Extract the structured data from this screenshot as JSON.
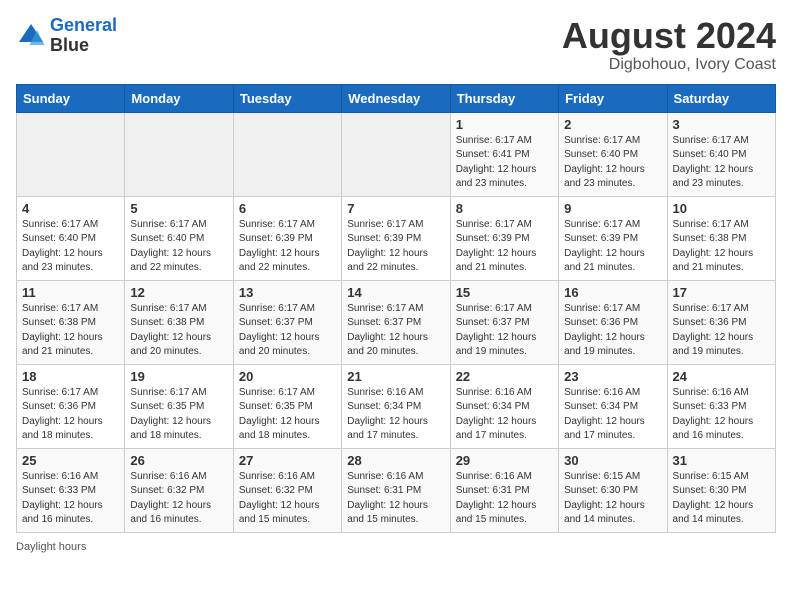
{
  "header": {
    "logo_line1": "General",
    "logo_line2": "Blue",
    "title": "August 2024",
    "subtitle": "Digbohouo, Ivory Coast"
  },
  "days_of_week": [
    "Sunday",
    "Monday",
    "Tuesday",
    "Wednesday",
    "Thursday",
    "Friday",
    "Saturday"
  ],
  "weeks": [
    [
      {
        "day": "",
        "detail": ""
      },
      {
        "day": "",
        "detail": ""
      },
      {
        "day": "",
        "detail": ""
      },
      {
        "day": "",
        "detail": ""
      },
      {
        "day": "1",
        "detail": "Sunrise: 6:17 AM\nSunset: 6:41 PM\nDaylight: 12 hours\nand 23 minutes."
      },
      {
        "day": "2",
        "detail": "Sunrise: 6:17 AM\nSunset: 6:40 PM\nDaylight: 12 hours\nand 23 minutes."
      },
      {
        "day": "3",
        "detail": "Sunrise: 6:17 AM\nSunset: 6:40 PM\nDaylight: 12 hours\nand 23 minutes."
      }
    ],
    [
      {
        "day": "4",
        "detail": "Sunrise: 6:17 AM\nSunset: 6:40 PM\nDaylight: 12 hours\nand 23 minutes."
      },
      {
        "day": "5",
        "detail": "Sunrise: 6:17 AM\nSunset: 6:40 PM\nDaylight: 12 hours\nand 22 minutes."
      },
      {
        "day": "6",
        "detail": "Sunrise: 6:17 AM\nSunset: 6:39 PM\nDaylight: 12 hours\nand 22 minutes."
      },
      {
        "day": "7",
        "detail": "Sunrise: 6:17 AM\nSunset: 6:39 PM\nDaylight: 12 hours\nand 22 minutes."
      },
      {
        "day": "8",
        "detail": "Sunrise: 6:17 AM\nSunset: 6:39 PM\nDaylight: 12 hours\nand 21 minutes."
      },
      {
        "day": "9",
        "detail": "Sunrise: 6:17 AM\nSunset: 6:39 PM\nDaylight: 12 hours\nand 21 minutes."
      },
      {
        "day": "10",
        "detail": "Sunrise: 6:17 AM\nSunset: 6:38 PM\nDaylight: 12 hours\nand 21 minutes."
      }
    ],
    [
      {
        "day": "11",
        "detail": "Sunrise: 6:17 AM\nSunset: 6:38 PM\nDaylight: 12 hours\nand 21 minutes."
      },
      {
        "day": "12",
        "detail": "Sunrise: 6:17 AM\nSunset: 6:38 PM\nDaylight: 12 hours\nand 20 minutes."
      },
      {
        "day": "13",
        "detail": "Sunrise: 6:17 AM\nSunset: 6:37 PM\nDaylight: 12 hours\nand 20 minutes."
      },
      {
        "day": "14",
        "detail": "Sunrise: 6:17 AM\nSunset: 6:37 PM\nDaylight: 12 hours\nand 20 minutes."
      },
      {
        "day": "15",
        "detail": "Sunrise: 6:17 AM\nSunset: 6:37 PM\nDaylight: 12 hours\nand 19 minutes."
      },
      {
        "day": "16",
        "detail": "Sunrise: 6:17 AM\nSunset: 6:36 PM\nDaylight: 12 hours\nand 19 minutes."
      },
      {
        "day": "17",
        "detail": "Sunrise: 6:17 AM\nSunset: 6:36 PM\nDaylight: 12 hours\nand 19 minutes."
      }
    ],
    [
      {
        "day": "18",
        "detail": "Sunrise: 6:17 AM\nSunset: 6:36 PM\nDaylight: 12 hours\nand 18 minutes."
      },
      {
        "day": "19",
        "detail": "Sunrise: 6:17 AM\nSunset: 6:35 PM\nDaylight: 12 hours\nand 18 minutes."
      },
      {
        "day": "20",
        "detail": "Sunrise: 6:17 AM\nSunset: 6:35 PM\nDaylight: 12 hours\nand 18 minutes."
      },
      {
        "day": "21",
        "detail": "Sunrise: 6:16 AM\nSunset: 6:34 PM\nDaylight: 12 hours\nand 17 minutes."
      },
      {
        "day": "22",
        "detail": "Sunrise: 6:16 AM\nSunset: 6:34 PM\nDaylight: 12 hours\nand 17 minutes."
      },
      {
        "day": "23",
        "detail": "Sunrise: 6:16 AM\nSunset: 6:34 PM\nDaylight: 12 hours\nand 17 minutes."
      },
      {
        "day": "24",
        "detail": "Sunrise: 6:16 AM\nSunset: 6:33 PM\nDaylight: 12 hours\nand 16 minutes."
      }
    ],
    [
      {
        "day": "25",
        "detail": "Sunrise: 6:16 AM\nSunset: 6:33 PM\nDaylight: 12 hours\nand 16 minutes."
      },
      {
        "day": "26",
        "detail": "Sunrise: 6:16 AM\nSunset: 6:32 PM\nDaylight: 12 hours\nand 16 minutes."
      },
      {
        "day": "27",
        "detail": "Sunrise: 6:16 AM\nSunset: 6:32 PM\nDaylight: 12 hours\nand 15 minutes."
      },
      {
        "day": "28",
        "detail": "Sunrise: 6:16 AM\nSunset: 6:31 PM\nDaylight: 12 hours\nand 15 minutes."
      },
      {
        "day": "29",
        "detail": "Sunrise: 6:16 AM\nSunset: 6:31 PM\nDaylight: 12 hours\nand 15 minutes."
      },
      {
        "day": "30",
        "detail": "Sunrise: 6:15 AM\nSunset: 6:30 PM\nDaylight: 12 hours\nand 14 minutes."
      },
      {
        "day": "31",
        "detail": "Sunrise: 6:15 AM\nSunset: 6:30 PM\nDaylight: 12 hours\nand 14 minutes."
      }
    ]
  ],
  "footer_text": "Daylight hours"
}
